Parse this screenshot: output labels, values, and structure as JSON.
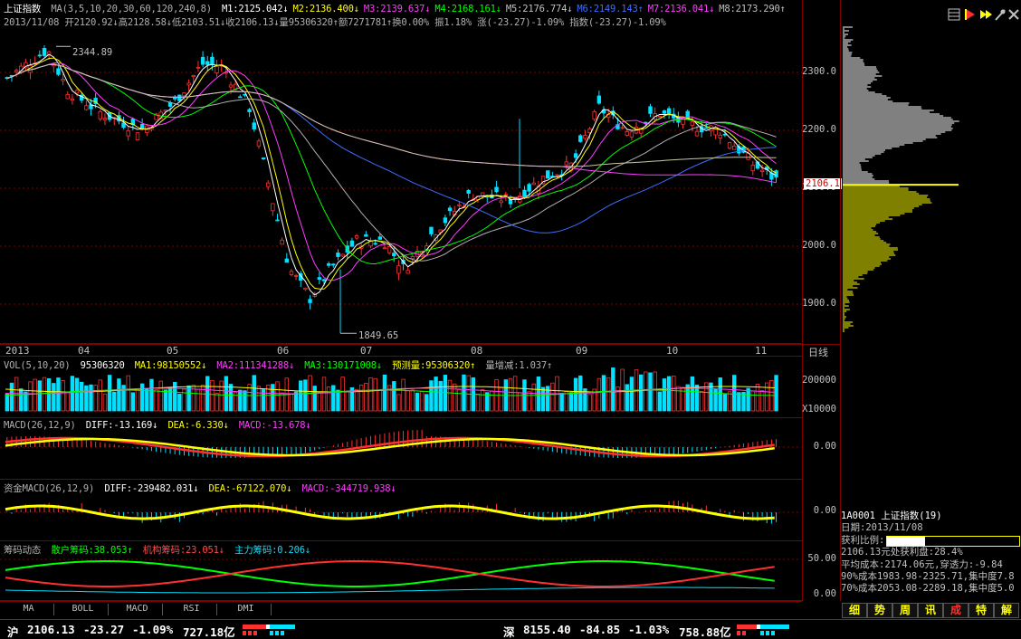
{
  "header": {
    "index_name": "上证指数",
    "ma_label": "MA(3,5,10,20,30,60,120,240,8)",
    "ma": [
      {
        "t": "M1:2125.042↓",
        "c": "#ffffff"
      },
      {
        "t": "M2:2136.400↓",
        "c": "#ffff00"
      },
      {
        "t": "M3:2139.637↓",
        "c": "#ff3cff"
      },
      {
        "t": "M4:2168.161↓",
        "c": "#00ff00"
      },
      {
        "t": "M5:2176.774↓",
        "c": "#c0c0c0"
      },
      {
        "t": "M6:2149.143↑",
        "c": "#3f6dff"
      },
      {
        "t": "M7:2136.041↓",
        "c": "#ff3cff"
      },
      {
        "t": "M8:2173.290↑",
        "c": "#c0c0c0"
      }
    ],
    "ohlc": "2013/11/08 开2120.92↓高2128.58↓低2103.51↓收2106.13↓量95306320↑额7271781↑换0.00% 振1.18% 涨(-23.27)-1.09% 指数(-23.27)-1.09%"
  },
  "toolbar_icons": [
    "grid-icon",
    "play-icon",
    "fast-forward-icon",
    "pin-icon",
    "tools-icon"
  ],
  "price_axis": [
    "2300.0",
    "2200.0",
    "2100.0",
    "2000.0",
    "1900.0"
  ],
  "current_price_tag": "2106.1",
  "annotations": {
    "high": "2344.89",
    "low": "1849.65"
  },
  "months": [
    "2013",
    "04",
    "05",
    "06",
    "07",
    "08",
    "09",
    "10",
    "11"
  ],
  "period_label": "日线",
  "vol": {
    "label": "VOL(5,10,20)",
    "value": "95306320",
    "ma1": "MA1:98150552↓",
    "ma2": "MA2:111341288↓",
    "ma3": "MA3:130171008↓",
    "forecast": "预测量:95306320↑",
    "change": "量增减:1.037↑",
    "axis": [
      "200000",
      "X10000"
    ]
  },
  "macd": {
    "label": "MACD(26,12,9)",
    "diff": "DIFF:-13.169↓",
    "dea": "DEA:-6.330↓",
    "macd": "MACD:-13.678↓",
    "axis": "0.00"
  },
  "fund_macd": {
    "label": "资金MACD(26,12,9)",
    "diff": "DIFF:-239482.031↓",
    "dea": "DEA:-67122.070↓",
    "macd": "MACD:-344719.938↓",
    "axis": "0.00"
  },
  "chips": {
    "label": "筹码动态",
    "retail": "散户筹码:38.053↑",
    "inst": "机构筹码:23.051↓",
    "main": "主力筹码:0.206↓",
    "axis": [
      "50.00",
      "0.00"
    ]
  },
  "tabs": [
    "MA",
    "BOLL",
    "MACD",
    "RSI",
    "DMI"
  ],
  "right_panel": {
    "code_line": "1A0001 上证指数(19)",
    "date": "日期:2013/11/08",
    "profit_label": "获利比例:",
    "profit_pct": "28.4%",
    "profit_ratio": 0.284,
    "line1": "2106.13元处获利盘:28.4%",
    "line2": "平均成本:2174.06元,穿透力:-9.84",
    "line3": "90%成本1983.98-2325.71,集中度7.8",
    "line4": "70%成本2053.08-2289.18,集中度5.0",
    "buttons": [
      "细",
      "势",
      "周",
      "讯",
      "成",
      "特",
      "解"
    ],
    "active_button": "成"
  },
  "status": {
    "sh_label": "沪",
    "sh_price": "2106.13",
    "sh_change": "-23.27",
    "sh_pct": "-1.09%",
    "sh_amount": "727.18亿",
    "sz_label": "深",
    "sz_price": "8155.40",
    "sz_change": "-84.85",
    "sz_pct": "-1.03%",
    "sz_amount": "758.88亿"
  }
}
